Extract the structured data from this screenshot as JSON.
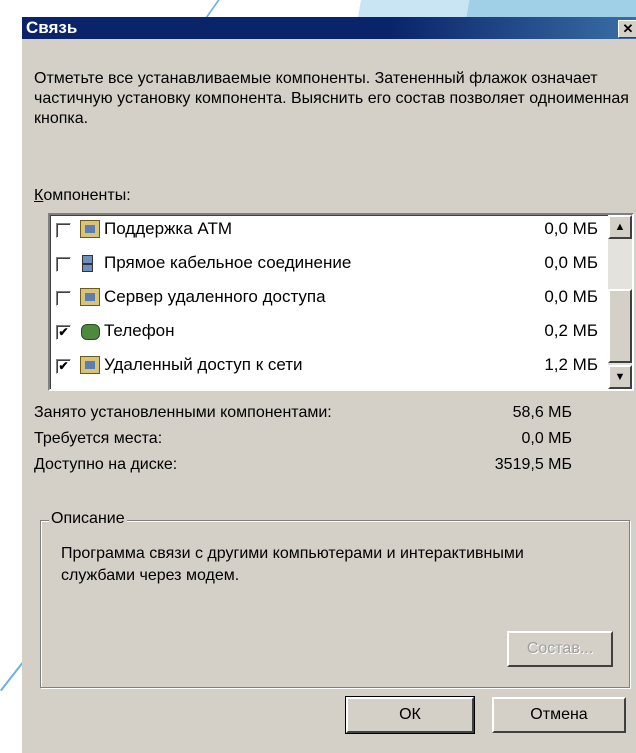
{
  "window": {
    "title": "Связь",
    "close_symbol": "✕"
  },
  "instructions": "Отметьте все устанавливаемые компоненты. Затененный флажок означает частичную установку компонента. Выяснить его состав позволяет одноименная кнопка.",
  "components_label": {
    "accel": "К",
    "rest": "омпоненты:"
  },
  "components": [
    {
      "label": "Поддержка ATM",
      "size": "0,0 МБ",
      "checked": false,
      "icon": "component-icon"
    },
    {
      "label": "Прямое кабельное соединение",
      "size": "0,0 МБ",
      "checked": false,
      "icon": "network-computers-icon"
    },
    {
      "label": "Сервер удаленного доступа",
      "size": "0,0 МБ",
      "checked": false,
      "icon": "component-icon"
    },
    {
      "label": "Телефон",
      "size": "0,2 МБ",
      "checked": true,
      "icon": "phone-icon"
    },
    {
      "label": "Удаленный доступ к сети",
      "size": "1,2 МБ",
      "checked": true,
      "icon": "component-icon"
    }
  ],
  "scroll": {
    "up": "▲",
    "down": "▼"
  },
  "stats": {
    "used_label": "Занято установленными компонентами:",
    "used_value": "58,6 МБ",
    "required_label": "Требуется места:",
    "required_value": "0,0 МБ",
    "available_label": "Доступно на диске:",
    "available_value": "3519,5 МБ"
  },
  "description": {
    "title": "Описание",
    "text": "Программа связи с другими компьютерами и интерактивными службами через модем."
  },
  "buttons": {
    "details": "Состав...",
    "ok": "ОК",
    "cancel": "Отмена"
  },
  "check_mark": "✔"
}
